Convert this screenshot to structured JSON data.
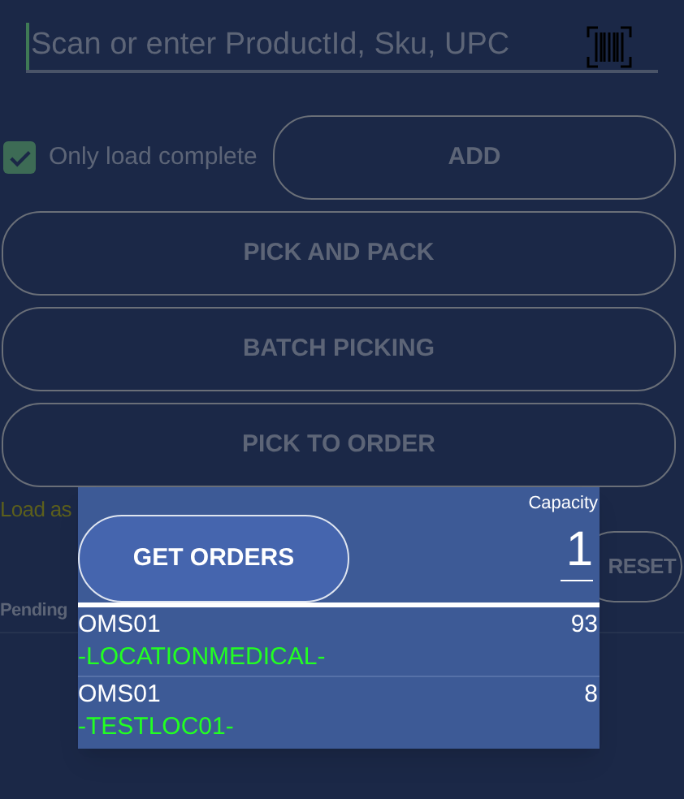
{
  "search": {
    "placeholder": "Scan or enter ProductId, Sku, UPC"
  },
  "only_load_complete": {
    "label": "Only load complete",
    "checked": true
  },
  "buttons": [
    "ADD",
    "PICK AND PACK",
    "BATCH PICKING",
    "PICK TO ORDER"
  ],
  "load_label": "Load as",
  "reset_button": "RESET",
  "pending_label": "Pending",
  "orders_popup": {
    "button": "GET ORDERS",
    "capacity_label": "Capacity",
    "capacity_value": "1",
    "orders": [
      {
        "name": "OMS01",
        "count": "93",
        "location": "-LOCATIONMEDICAL-"
      },
      {
        "name": "OMS01",
        "count": "8",
        "location": "-TESTLOC01-"
      }
    ]
  }
}
